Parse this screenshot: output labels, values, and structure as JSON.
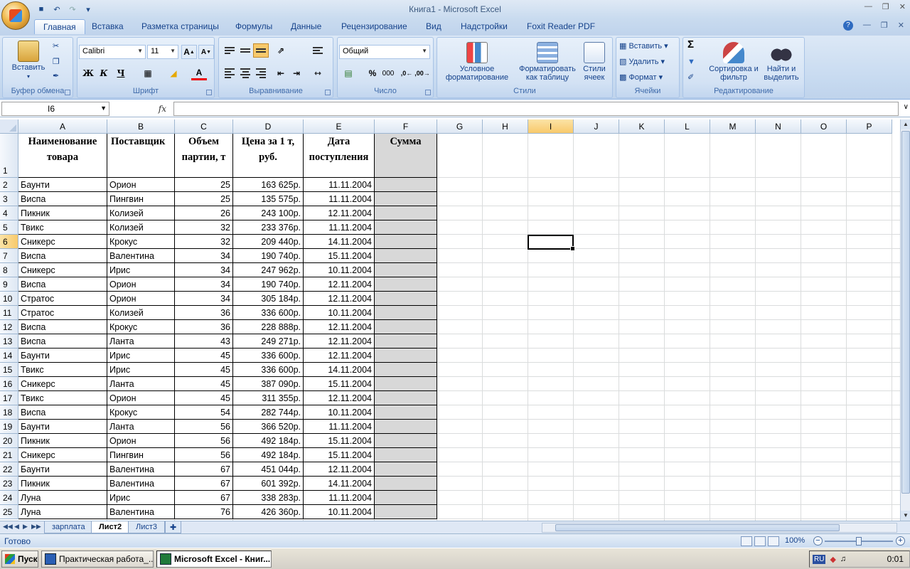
{
  "app": {
    "title": "Книга1 - Microsoft Excel"
  },
  "tabs": [
    "Главная",
    "Вставка",
    "Разметка страницы",
    "Формулы",
    "Данные",
    "Рецензирование",
    "Вид",
    "Надстройки",
    "Foxit Reader PDF"
  ],
  "ribbon": {
    "clipboard": {
      "label": "Буфер обмена",
      "paste": "Вставить"
    },
    "font": {
      "label": "Шрифт",
      "name": "Calibri",
      "size": "11",
      "bold": "Ж",
      "italic": "К",
      "underline": "Ч"
    },
    "alignment": {
      "label": "Выравнивание"
    },
    "number": {
      "label": "Число",
      "format": "Общий",
      "percent": "%",
      "thousands": "000"
    },
    "styles": {
      "label": "Стили",
      "conditional": "Условное форматирование",
      "as_table": "Форматировать как таблицу",
      "cell_styles": "Стили ячеек"
    },
    "cells": {
      "label": "Ячейки",
      "insert": "Вставить",
      "delete": "Удалить",
      "format": "Формат"
    },
    "editing": {
      "label": "Редактирование",
      "sigma": "Σ",
      "sort": "Сортировка и фильтр",
      "find": "Найти и выделить"
    }
  },
  "formula_bar": {
    "name_box": "I6",
    "fx": "fx",
    "content": ""
  },
  "columns": [
    "A",
    "B",
    "C",
    "D",
    "E",
    "F",
    "G",
    "H",
    "I",
    "J",
    "K",
    "L",
    "M",
    "N",
    "O",
    "P"
  ],
  "selected": {
    "column": "I",
    "row": 6
  },
  "header_row": {
    "a": "Наименование\nтовара",
    "b": "Поставщик",
    "c": "Объем\nпартии, т",
    "d": "Цена за 1 т,\nруб.",
    "e": "Дата\nпоступления",
    "f": "Сумма"
  },
  "rows": [
    [
      "Баунти",
      "Орион",
      "25",
      "163 625р.",
      "11.11.2004"
    ],
    [
      "Виспа",
      "Пингвин",
      "25",
      "135 575р.",
      "11.11.2004"
    ],
    [
      "Пикник",
      "Колизей",
      "26",
      "243 100р.",
      "12.11.2004"
    ],
    [
      "Твикс",
      "Колизей",
      "32",
      "233 376р.",
      "11.11.2004"
    ],
    [
      "Сникерс",
      "Крокус",
      "32",
      "209 440р.",
      "14.11.2004"
    ],
    [
      "Виспа",
      "Валентина",
      "34",
      "190 740р.",
      "15.11.2004"
    ],
    [
      "Сникерс",
      "Ирис",
      "34",
      "247 962р.",
      "10.11.2004"
    ],
    [
      "Виспа",
      "Орион",
      "34",
      "190 740р.",
      "12.11.2004"
    ],
    [
      "Стратос",
      "Орион",
      "34",
      "305 184р.",
      "12.11.2004"
    ],
    [
      "Стратос",
      "Колизей",
      "36",
      "336 600р.",
      "10.11.2004"
    ],
    [
      "Виспа",
      "Крокус",
      "36",
      "228 888р.",
      "12.11.2004"
    ],
    [
      "Виспа",
      "Ланта",
      "43",
      "249 271р.",
      "12.11.2004"
    ],
    [
      "Баунти",
      "Ирис",
      "45",
      "336 600р.",
      "12.11.2004"
    ],
    [
      "Твикс",
      "Ирис",
      "45",
      "336 600р.",
      "14.11.2004"
    ],
    [
      "Сникерс",
      "Ланта",
      "45",
      "387 090р.",
      "15.11.2004"
    ],
    [
      "Твикс",
      "Орион",
      "45",
      "311 355р.",
      "12.11.2004"
    ],
    [
      "Виспа",
      "Крокус",
      "54",
      "282 744р.",
      "10.11.2004"
    ],
    [
      "Баунти",
      "Ланта",
      "56",
      "366 520р.",
      "11.11.2004"
    ],
    [
      "Пикник",
      "Орион",
      "56",
      "492 184р.",
      "15.11.2004"
    ],
    [
      "Сникерс",
      "Пингвин",
      "56",
      "492 184р.",
      "15.11.2004"
    ],
    [
      "Баунти",
      "Валентина",
      "67",
      "451 044р.",
      "12.11.2004"
    ],
    [
      "Пикник",
      "Валентина",
      "67",
      "601 392р.",
      "14.11.2004"
    ],
    [
      "Луна",
      "Ирис",
      "67",
      "338 283р.",
      "11.11.2004"
    ],
    [
      "Луна",
      "Валентина",
      "76",
      "426 360р.",
      "10.11.2004"
    ]
  ],
  "sheets": [
    {
      "name": "зарплата",
      "active": false
    },
    {
      "name": "Лист2",
      "active": true
    },
    {
      "name": "Лист3",
      "active": false
    }
  ],
  "status": {
    "text": "Готово",
    "zoom": "100%"
  },
  "taskbar": {
    "start": "Пуск",
    "items": [
      {
        "label": "Практическая работа_...",
        "active": false
      },
      {
        "label": "Microsoft Excel - Книг...",
        "active": true
      }
    ],
    "lang": "RU",
    "clock": "0:01"
  }
}
